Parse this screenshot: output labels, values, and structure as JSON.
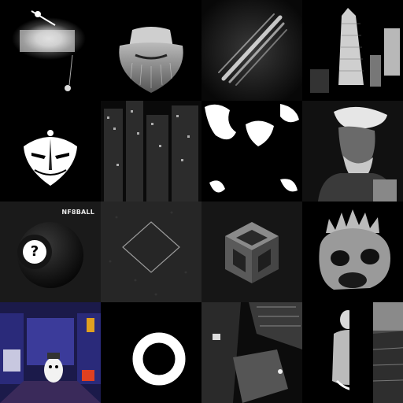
{
  "gallery": {
    "nft_tile": {
      "brand_label": "NF8BALL",
      "glyph": "?"
    }
  }
}
